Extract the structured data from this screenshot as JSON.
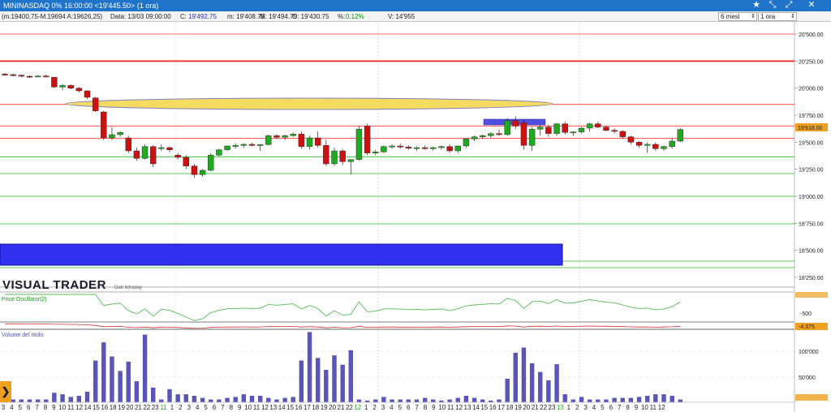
{
  "window": {
    "title": "MININASDAQ 0% 16:00:00  <19'445.50>  (1 ora)",
    "controls": [
      "★",
      "⤡",
      "⤢",
      "—",
      "□",
      "✕"
    ]
  },
  "infobar": {
    "indicator": "(m.19400,75-M.19694 A:19626,25)",
    "date": "Data: 13/03 09:00:00",
    "close_label": "C:",
    "close_value": "19'492.75",
    "min": "m: 19'408.75",
    "max": "M: 19'494.75",
    "open": "O: 19'430.75",
    "pct_label": "%:",
    "pct_value": "0.12%",
    "volume": "V: 14'955",
    "period_select": "6 mesi",
    "interval_select": "1 ora"
  },
  "price_axis": {
    "ticks": [
      "20'500.00",
      "20'250.00",
      "20'000.00",
      "19'750.00",
      "19'500.00",
      "19'250.00",
      "19'000.00",
      "18'750.00",
      "18'500.00",
      "18'250.00"
    ],
    "current_price": "19'618.00"
  },
  "oscillator": {
    "label": "Price Oscillator(2)",
    "tick": "-500",
    "value_badge": "-4.375"
  },
  "volume_pane": {
    "label": "Volume del titolo",
    "ticks": [
      "100'000",
      "50'000"
    ],
    "volumes": [
      5,
      5,
      5,
      5,
      5,
      5,
      18,
      15,
      10,
      12,
      20,
      80,
      115,
      88,
      60,
      78,
      40,
      130,
      28,
      5,
      25,
      15,
      15,
      12,
      8,
      5,
      5,
      8,
      10,
      15,
      12,
      12,
      8,
      5,
      8,
      10,
      80,
      135,
      85,
      62,
      90,
      72,
      100,
      5,
      3,
      5,
      10,
      5,
      5,
      5,
      5,
      8,
      5,
      3,
      5,
      8,
      12,
      8,
      5,
      3,
      5,
      45,
      95,
      105,
      75,
      58,
      42,
      73,
      15,
      5,
      10,
      5,
      5,
      5,
      8,
      8,
      8,
      10,
      12,
      15,
      15,
      12,
      5
    ]
  },
  "brand": {
    "name": "VISUAL TRADER",
    "sub": "Dati Intraday"
  },
  "dates": [
    "3",
    "4",
    "5",
    "6",
    "7",
    "8",
    "9",
    "10",
    "11",
    "12",
    "14",
    "15",
    "16",
    "18",
    "19",
    "20",
    "21",
    "22",
    "23",
    "11",
    "1",
    "2",
    "3",
    "4",
    "5",
    "6",
    "7",
    "8",
    "9",
    "10",
    "11",
    "12",
    "13",
    "14",
    "15",
    "16",
    "17",
    "18",
    "19",
    "20",
    "21",
    "22",
    "12",
    "1",
    "2",
    "3",
    "4",
    "5",
    "6",
    "7",
    "8",
    "9",
    "10",
    "11",
    "12",
    "13",
    "14",
    "15",
    "16",
    "17",
    "18",
    "19",
    "20",
    "21",
    "22",
    "23",
    "13",
    "1",
    "2",
    "3",
    "4",
    "5",
    "6",
    "7",
    "8",
    "9",
    "10",
    "11",
    "12"
  ],
  "green_date_indices": [
    19,
    42,
    66
  ],
  "candles": [
    {
      "o": 20130,
      "h": 20140,
      "l": 20115,
      "c": 20125
    },
    {
      "o": 20125,
      "h": 20135,
      "l": 20110,
      "c": 20120
    },
    {
      "o": 20120,
      "h": 20125,
      "l": 20100,
      "c": 20110
    },
    {
      "o": 20110,
      "h": 20118,
      "l": 20095,
      "c": 20105
    },
    {
      "o": 20105,
      "h": 20118,
      "l": 20100,
      "c": 20112
    },
    {
      "o": 20112,
      "h": 20125,
      "l": 20100,
      "c": 20105
    },
    {
      "o": 20100,
      "h": 20105,
      "l": 20000,
      "c": 20010
    },
    {
      "o": 20010,
      "h": 20040,
      "l": 19980,
      "c": 20025
    },
    {
      "o": 20025,
      "h": 20035,
      "l": 19990,
      "c": 20000
    },
    {
      "o": 20000,
      "h": 20010,
      "l": 19960,
      "c": 19975
    },
    {
      "o": 19975,
      "h": 19980,
      "l": 19900,
      "c": 19915
    },
    {
      "o": 19910,
      "h": 19920,
      "l": 19780,
      "c": 19790
    },
    {
      "o": 19780,
      "h": 19790,
      "l": 19520,
      "c": 19540
    },
    {
      "o": 19540,
      "h": 19640,
      "l": 19520,
      "c": 19570
    },
    {
      "o": 19570,
      "h": 19600,
      "l": 19550,
      "c": 19590
    },
    {
      "o": 19540,
      "h": 19560,
      "l": 19400,
      "c": 19420
    },
    {
      "o": 19420,
      "h": 19450,
      "l": 19330,
      "c": 19350
    },
    {
      "o": 19350,
      "h": 19480,
      "l": 19340,
      "c": 19460
    },
    {
      "o": 19460,
      "h": 19470,
      "l": 19270,
      "c": 19300
    },
    {
      "o": 19440,
      "h": 19480,
      "l": 19420,
      "c": 19450
    },
    {
      "o": 19450,
      "h": 19460,
      "l": 19410,
      "c": 19430
    },
    {
      "o": 19380,
      "h": 19400,
      "l": 19340,
      "c": 19360
    },
    {
      "o": 19360,
      "h": 19380,
      "l": 19250,
      "c": 19280
    },
    {
      "o": 19280,
      "h": 19300,
      "l": 19170,
      "c": 19200
    },
    {
      "o": 19200,
      "h": 19250,
      "l": 19180,
      "c": 19240
    },
    {
      "o": 19240,
      "h": 19400,
      "l": 19230,
      "c": 19380
    },
    {
      "o": 19380,
      "h": 19440,
      "l": 19370,
      "c": 19430
    },
    {
      "o": 19430,
      "h": 19470,
      "l": 19420,
      "c": 19465
    },
    {
      "o": 19465,
      "h": 19490,
      "l": 19440,
      "c": 19470
    },
    {
      "o": 19470,
      "h": 19490,
      "l": 19450,
      "c": 19480
    },
    {
      "o": 19480,
      "h": 19495,
      "l": 19460,
      "c": 19470
    },
    {
      "o": 19470,
      "h": 19480,
      "l": 19420,
      "c": 19478
    },
    {
      "o": 19478,
      "h": 19570,
      "l": 19470,
      "c": 19560
    },
    {
      "o": 19560,
      "h": 19575,
      "l": 19530,
      "c": 19545
    },
    {
      "o": 19545,
      "h": 19570,
      "l": 19520,
      "c": 19560
    },
    {
      "o": 19560,
      "h": 19590,
      "l": 19550,
      "c": 19575
    },
    {
      "o": 19575,
      "h": 19600,
      "l": 19440,
      "c": 19460
    },
    {
      "o": 19460,
      "h": 19560,
      "l": 19430,
      "c": 19540
    },
    {
      "o": 19540,
      "h": 19600,
      "l": 19450,
      "c": 19470
    },
    {
      "o": 19470,
      "h": 19520,
      "l": 19280,
      "c": 19300
    },
    {
      "o": 19300,
      "h": 19450,
      "l": 19280,
      "c": 19420
    },
    {
      "o": 19420,
      "h": 19440,
      "l": 19290,
      "c": 19320
    },
    {
      "o": 19320,
      "h": 19340,
      "l": 19200,
      "c": 19340
    },
    {
      "o": 19340,
      "h": 19650,
      "l": 19330,
      "c": 19620
    },
    {
      "o": 19650,
      "h": 19670,
      "l": 19380,
      "c": 19400
    },
    {
      "o": 19400,
      "h": 19430,
      "l": 19380,
      "c": 19410
    },
    {
      "o": 19410,
      "h": 19470,
      "l": 19400,
      "c": 19460
    },
    {
      "o": 19460,
      "h": 19480,
      "l": 19440,
      "c": 19465
    },
    {
      "o": 19465,
      "h": 19485,
      "l": 19440,
      "c": 19455
    },
    {
      "o": 19455,
      "h": 19470,
      "l": 19430,
      "c": 19445
    },
    {
      "o": 19445,
      "h": 19460,
      "l": 19420,
      "c": 19450
    },
    {
      "o": 19450,
      "h": 19470,
      "l": 19430,
      "c": 19440
    },
    {
      "o": 19440,
      "h": 19460,
      "l": 19420,
      "c": 19450
    },
    {
      "o": 19450,
      "h": 19470,
      "l": 19430,
      "c": 19460
    },
    {
      "o": 19460,
      "h": 19480,
      "l": 19400,
      "c": 19420
    },
    {
      "o": 19420,
      "h": 19470,
      "l": 19400,
      "c": 19465
    },
    {
      "o": 19465,
      "h": 19540,
      "l": 19450,
      "c": 19530
    },
    {
      "o": 19530,
      "h": 19560,
      "l": 19510,
      "c": 19550
    },
    {
      "o": 19550,
      "h": 19570,
      "l": 19530,
      "c": 19560
    },
    {
      "o": 19560,
      "h": 19590,
      "l": 19540,
      "c": 19580
    },
    {
      "o": 19580,
      "h": 19620,
      "l": 19560,
      "c": 19570
    },
    {
      "o": 19570,
      "h": 19720,
      "l": 19560,
      "c": 19700
    },
    {
      "o": 19700,
      "h": 19740,
      "l": 19620,
      "c": 19650
    },
    {
      "o": 19680,
      "h": 19710,
      "l": 19430,
      "c": 19470
    },
    {
      "o": 19470,
      "h": 19640,
      "l": 19420,
      "c": 19620
    },
    {
      "o": 19620,
      "h": 19660,
      "l": 19560,
      "c": 19640
    },
    {
      "o": 19640,
      "h": 19660,
      "l": 19550,
      "c": 19580
    },
    {
      "o": 19580,
      "h": 19680,
      "l": 19560,
      "c": 19670
    },
    {
      "o": 19670,
      "h": 19690,
      "l": 19570,
      "c": 19590
    },
    {
      "o": 19590,
      "h": 19600,
      "l": 19560,
      "c": 19595
    },
    {
      "o": 19595,
      "h": 19640,
      "l": 19580,
      "c": 19630
    },
    {
      "o": 19630,
      "h": 19680,
      "l": 19600,
      "c": 19670
    },
    {
      "o": 19670,
      "h": 19690,
      "l": 19630,
      "c": 19640
    },
    {
      "o": 19640,
      "h": 19650,
      "l": 19600,
      "c": 19610
    },
    {
      "o": 19610,
      "h": 19630,
      "l": 19580,
      "c": 19600
    },
    {
      "o": 19600,
      "h": 19610,
      "l": 19530,
      "c": 19550
    },
    {
      "o": 19550,
      "h": 19560,
      "l": 19480,
      "c": 19500
    },
    {
      "o": 19500,
      "h": 19510,
      "l": 19450,
      "c": 19470
    },
    {
      "o": 19470,
      "h": 19500,
      "l": 19400,
      "c": 19480
    },
    {
      "o": 19480,
      "h": 19500,
      "l": 19420,
      "c": 19440
    },
    {
      "o": 19440,
      "h": 19470,
      "l": 19420,
      "c": 19460
    },
    {
      "o": 19460,
      "h": 19540,
      "l": 19440,
      "c": 19510
    },
    {
      "o": 19510,
      "h": 19630,
      "l": 19500,
      "c": 19618
    }
  ],
  "colors": {
    "up": "#1faa1f",
    "down": "#cc1111",
    "resistance": "#ff3030",
    "support": "#22bb22",
    "zone_blue": "#3030ee",
    "ellipse_fill": "#f5dc60",
    "ellipse_stroke": "#8080c0",
    "titlebar": "#1f74c9",
    "volume_bar": "#5a55bb",
    "oscillator": "#55bb55",
    "current_price_bg": "#f0a020"
  }
}
